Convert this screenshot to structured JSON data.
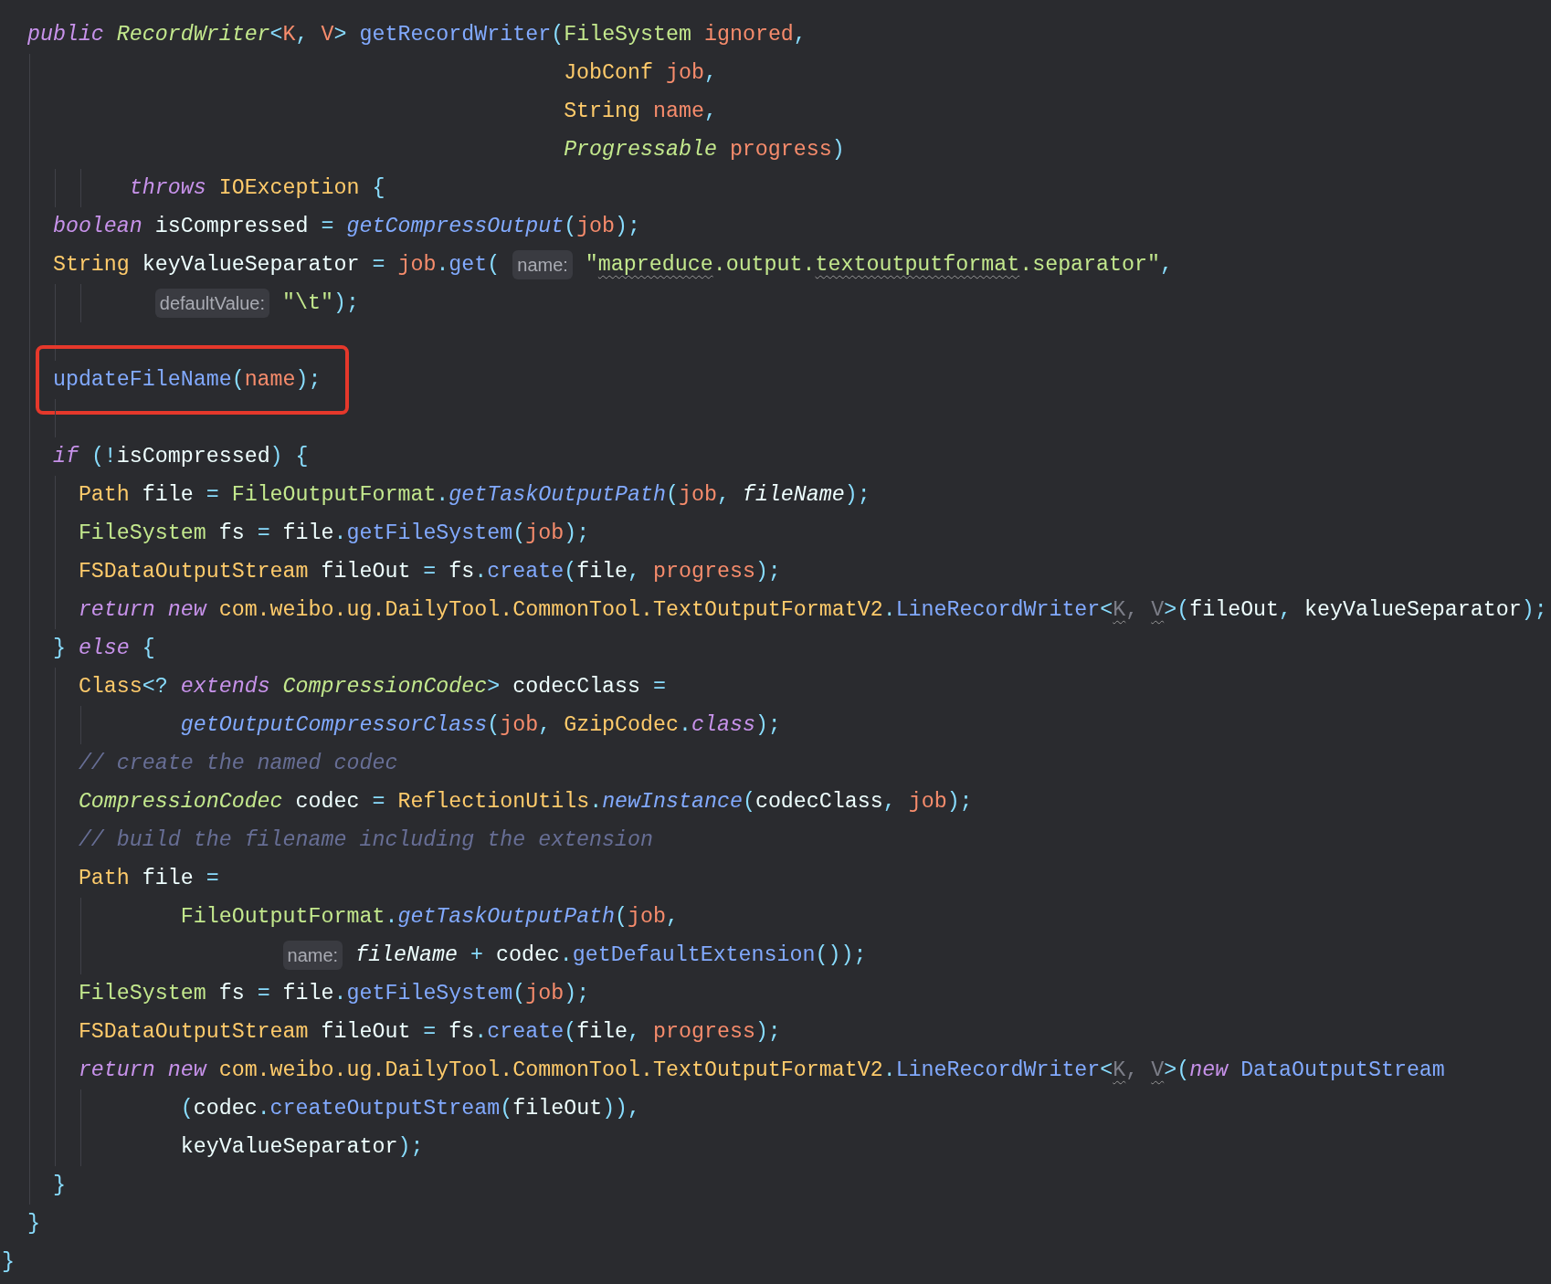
{
  "editor": {
    "lines": [
      {
        "kind": "code",
        "tokens": [
          {
            "kind": "keyword",
            "text": "  public "
          },
          {
            "kind": "type-green-italic",
            "text": "RecordWriter"
          },
          {
            "kind": "punct",
            "text": "<"
          },
          {
            "kind": "param",
            "text": "K"
          },
          {
            "kind": "punct",
            "text": ", "
          },
          {
            "kind": "param",
            "text": "V"
          },
          {
            "kind": "punct",
            "text": "> "
          },
          {
            "kind": "method",
            "text": "getRecordWriter"
          },
          {
            "kind": "punct",
            "text": "("
          },
          {
            "kind": "type-green",
            "text": "FileSystem "
          },
          {
            "kind": "param",
            "text": "ignored"
          },
          {
            "kind": "punct",
            "text": ","
          }
        ]
      },
      {
        "kind": "code",
        "tokens": [
          {
            "kind": "type",
            "text": "                                            JobConf "
          },
          {
            "kind": "param",
            "text": "job"
          },
          {
            "kind": "punct",
            "text": ","
          }
        ]
      },
      {
        "kind": "code",
        "tokens": [
          {
            "kind": "type",
            "text": "                                            String "
          },
          {
            "kind": "param",
            "text": "name"
          },
          {
            "kind": "punct",
            "text": ","
          }
        ]
      },
      {
        "kind": "code",
        "tokens": [
          {
            "kind": "type-green-italic",
            "text": "                                            Progressable "
          },
          {
            "kind": "param",
            "text": "progress"
          },
          {
            "kind": "punct",
            "text": ")"
          }
        ]
      },
      {
        "kind": "code",
        "tokens": [
          {
            "kind": "keyword",
            "text": "          throws "
          },
          {
            "kind": "type",
            "text": "IOException "
          },
          {
            "kind": "punct",
            "text": "{"
          }
        ]
      },
      {
        "kind": "code",
        "tokens": [
          {
            "kind": "keyword",
            "text": "    boolean "
          },
          {
            "kind": "plain",
            "text": "isCompressed "
          },
          {
            "kind": "punct",
            "text": "= "
          },
          {
            "kind": "method-italic",
            "text": "getCompressOutput"
          },
          {
            "kind": "punct",
            "text": "("
          },
          {
            "kind": "param",
            "text": "job"
          },
          {
            "kind": "punct",
            "text": ");"
          }
        ]
      },
      {
        "kind": "code",
        "tokens": [
          {
            "kind": "type",
            "text": "    String "
          },
          {
            "kind": "plain",
            "text": "keyValueSeparator "
          },
          {
            "kind": "punct",
            "text": "= "
          },
          {
            "kind": "param",
            "text": "job"
          },
          {
            "kind": "punct",
            "text": "."
          },
          {
            "kind": "method",
            "text": "get"
          },
          {
            "kind": "punct",
            "text": "( "
          },
          {
            "kind": "hint",
            "text": "name:"
          },
          {
            "kind": "string",
            "text": " \""
          },
          {
            "kind": "string-typo",
            "text": "mapreduce"
          },
          {
            "kind": "string",
            "text": ".output."
          },
          {
            "kind": "string-typo",
            "text": "textoutputformat"
          },
          {
            "kind": "string",
            "text": ".separator\""
          },
          {
            "kind": "punct",
            "text": ","
          }
        ]
      },
      {
        "kind": "code",
        "tokens": [
          {
            "kind": "hint",
            "text": "            defaultValue:"
          },
          {
            "kind": "string",
            "text": " \"\\t\""
          },
          {
            "kind": "punct",
            "text": ");"
          }
        ]
      },
      {
        "kind": "blank"
      },
      {
        "kind": "code",
        "highlighted": true,
        "tokens": [
          {
            "kind": "method",
            "text": "    updateFileName"
          },
          {
            "kind": "punct",
            "text": "("
          },
          {
            "kind": "param",
            "text": "name"
          },
          {
            "kind": "punct",
            "text": ");"
          }
        ]
      },
      {
        "kind": "blank"
      },
      {
        "kind": "code",
        "tokens": [
          {
            "kind": "keyword",
            "text": "    if "
          },
          {
            "kind": "punct",
            "text": "(!"
          },
          {
            "kind": "plain",
            "text": "isCompressed"
          },
          {
            "kind": "punct",
            "text": ") {"
          }
        ]
      },
      {
        "kind": "code",
        "tokens": [
          {
            "kind": "type",
            "text": "      Path "
          },
          {
            "kind": "plain",
            "text": "file "
          },
          {
            "kind": "punct",
            "text": "= "
          },
          {
            "kind": "type-green",
            "text": "FileOutputFormat"
          },
          {
            "kind": "punct",
            "text": "."
          },
          {
            "kind": "method-italic",
            "text": "getTaskOutputPath"
          },
          {
            "kind": "punct",
            "text": "("
          },
          {
            "kind": "param",
            "text": "job"
          },
          {
            "kind": "punct",
            "text": ", "
          },
          {
            "kind": "plain-italic",
            "text": "fileName"
          },
          {
            "kind": "punct",
            "text": ");"
          }
        ]
      },
      {
        "kind": "code",
        "tokens": [
          {
            "kind": "type-green",
            "text": "      FileSystem "
          },
          {
            "kind": "plain",
            "text": "fs "
          },
          {
            "kind": "punct",
            "text": "= "
          },
          {
            "kind": "plain",
            "text": "file"
          },
          {
            "kind": "punct",
            "text": "."
          },
          {
            "kind": "method",
            "text": "getFileSystem"
          },
          {
            "kind": "punct",
            "text": "("
          },
          {
            "kind": "param",
            "text": "job"
          },
          {
            "kind": "punct",
            "text": ");"
          }
        ]
      },
      {
        "kind": "code",
        "tokens": [
          {
            "kind": "type",
            "text": "      FSDataOutputStream "
          },
          {
            "kind": "plain",
            "text": "fileOut "
          },
          {
            "kind": "punct",
            "text": "= "
          },
          {
            "kind": "plain",
            "text": "fs"
          },
          {
            "kind": "punct",
            "text": "."
          },
          {
            "kind": "method",
            "text": "create"
          },
          {
            "kind": "punct",
            "text": "("
          },
          {
            "kind": "plain",
            "text": "file"
          },
          {
            "kind": "punct",
            "text": ", "
          },
          {
            "kind": "param",
            "text": "progress"
          },
          {
            "kind": "punct",
            "text": ");"
          }
        ]
      },
      {
        "kind": "code",
        "tokens": [
          {
            "kind": "keyword",
            "text": "      return new "
          },
          {
            "kind": "type",
            "text": "com.weibo.ug.DailyTool.CommonTool.TextOutputFormatV2"
          },
          {
            "kind": "punct",
            "text": "."
          },
          {
            "kind": "method",
            "text": "LineRecordWriter"
          },
          {
            "kind": "punct",
            "text": "<"
          },
          {
            "kind": "dim-typo",
            "text": "K"
          },
          {
            "kind": "dim",
            "text": ", "
          },
          {
            "kind": "dim-typo",
            "text": "V"
          },
          {
            "kind": "punct",
            "text": ">("
          },
          {
            "kind": "plain",
            "text": "fileOut"
          },
          {
            "kind": "punct",
            "text": ", "
          },
          {
            "kind": "plain",
            "text": "keyValueSeparator"
          },
          {
            "kind": "punct",
            "text": ");"
          }
        ]
      },
      {
        "kind": "code",
        "tokens": [
          {
            "kind": "punct",
            "text": "    } "
          },
          {
            "kind": "keyword",
            "text": "else "
          },
          {
            "kind": "punct",
            "text": "{"
          }
        ]
      },
      {
        "kind": "code",
        "tokens": [
          {
            "kind": "type",
            "text": "      Class"
          },
          {
            "kind": "punct",
            "text": "<? "
          },
          {
            "kind": "keyword",
            "text": "extends "
          },
          {
            "kind": "type-green-italic",
            "text": "CompressionCodec"
          },
          {
            "kind": "punct",
            "text": "> "
          },
          {
            "kind": "plain",
            "text": "codecClass "
          },
          {
            "kind": "punct",
            "text": "="
          }
        ]
      },
      {
        "kind": "code",
        "tokens": [
          {
            "kind": "method-italic",
            "text": "              getOutputCompressorClass"
          },
          {
            "kind": "punct",
            "text": "("
          },
          {
            "kind": "param",
            "text": "job"
          },
          {
            "kind": "punct",
            "text": ", "
          },
          {
            "kind": "type",
            "text": "GzipCodec"
          },
          {
            "kind": "punct",
            "text": "."
          },
          {
            "kind": "keyword",
            "text": "class"
          },
          {
            "kind": "punct",
            "text": ");"
          }
        ]
      },
      {
        "kind": "code",
        "tokens": [
          {
            "kind": "comment",
            "text": "      // create the named codec"
          }
        ]
      },
      {
        "kind": "code",
        "tokens": [
          {
            "kind": "type-green-italic",
            "text": "      CompressionCodec "
          },
          {
            "kind": "plain",
            "text": "codec "
          },
          {
            "kind": "punct",
            "text": "= "
          },
          {
            "kind": "type",
            "text": "ReflectionUtils"
          },
          {
            "kind": "punct",
            "text": "."
          },
          {
            "kind": "method-italic",
            "text": "newInstance"
          },
          {
            "kind": "punct",
            "text": "("
          },
          {
            "kind": "plain",
            "text": "codecClass"
          },
          {
            "kind": "punct",
            "text": ", "
          },
          {
            "kind": "param",
            "text": "job"
          },
          {
            "kind": "punct",
            "text": ");"
          }
        ]
      },
      {
        "kind": "code",
        "tokens": [
          {
            "kind": "comment",
            "text": "      // build the filename including the extension"
          }
        ]
      },
      {
        "kind": "code",
        "tokens": [
          {
            "kind": "type",
            "text": "      Path "
          },
          {
            "kind": "plain",
            "text": "file "
          },
          {
            "kind": "punct",
            "text": "="
          }
        ]
      },
      {
        "kind": "code",
        "tokens": [
          {
            "kind": "type-green",
            "text": "              FileOutputFormat"
          },
          {
            "kind": "punct",
            "text": "."
          },
          {
            "kind": "method-italic",
            "text": "getTaskOutputPath"
          },
          {
            "kind": "punct",
            "text": "("
          },
          {
            "kind": "param",
            "text": "job"
          },
          {
            "kind": "punct",
            "text": ","
          }
        ]
      },
      {
        "kind": "code",
        "tokens": [
          {
            "kind": "hint",
            "text": "                      name:"
          },
          {
            "kind": "plain-italic",
            "text": " fileName "
          },
          {
            "kind": "punct",
            "text": "+ "
          },
          {
            "kind": "plain",
            "text": "codec"
          },
          {
            "kind": "punct",
            "text": "."
          },
          {
            "kind": "method",
            "text": "getDefaultExtension"
          },
          {
            "kind": "punct",
            "text": "());"
          }
        ]
      },
      {
        "kind": "code",
        "tokens": [
          {
            "kind": "type-green",
            "text": "      FileSystem "
          },
          {
            "kind": "plain",
            "text": "fs "
          },
          {
            "kind": "punct",
            "text": "= "
          },
          {
            "kind": "plain",
            "text": "file"
          },
          {
            "kind": "punct",
            "text": "."
          },
          {
            "kind": "method",
            "text": "getFileSystem"
          },
          {
            "kind": "punct",
            "text": "("
          },
          {
            "kind": "param",
            "text": "job"
          },
          {
            "kind": "punct",
            "text": ");"
          }
        ]
      },
      {
        "kind": "code",
        "tokens": [
          {
            "kind": "type",
            "text": "      FSDataOutputStream "
          },
          {
            "kind": "plain",
            "text": "fileOut "
          },
          {
            "kind": "punct",
            "text": "= "
          },
          {
            "kind": "plain",
            "text": "fs"
          },
          {
            "kind": "punct",
            "text": "."
          },
          {
            "kind": "method",
            "text": "create"
          },
          {
            "kind": "punct",
            "text": "("
          },
          {
            "kind": "plain",
            "text": "file"
          },
          {
            "kind": "punct",
            "text": ", "
          },
          {
            "kind": "param",
            "text": "progress"
          },
          {
            "kind": "punct",
            "text": ");"
          }
        ]
      },
      {
        "kind": "code",
        "tokens": [
          {
            "kind": "keyword",
            "text": "      return new "
          },
          {
            "kind": "type",
            "text": "com.weibo.ug.DailyTool.CommonTool.TextOutputFormatV2"
          },
          {
            "kind": "punct",
            "text": "."
          },
          {
            "kind": "method",
            "text": "LineRecordWriter"
          },
          {
            "kind": "punct",
            "text": "<"
          },
          {
            "kind": "dim-typo",
            "text": "K"
          },
          {
            "kind": "dim",
            "text": ", "
          },
          {
            "kind": "dim-typo",
            "text": "V"
          },
          {
            "kind": "punct",
            "text": ">("
          },
          {
            "kind": "keyword",
            "text": "new "
          },
          {
            "kind": "method",
            "text": "DataOutputStream"
          }
        ]
      },
      {
        "kind": "code",
        "tokens": [
          {
            "kind": "punct",
            "text": "              ("
          },
          {
            "kind": "plain",
            "text": "codec"
          },
          {
            "kind": "punct",
            "text": "."
          },
          {
            "kind": "method",
            "text": "createOutputStream"
          },
          {
            "kind": "punct",
            "text": "("
          },
          {
            "kind": "plain",
            "text": "fileOut"
          },
          {
            "kind": "punct",
            "text": ")),"
          }
        ]
      },
      {
        "kind": "code",
        "tokens": [
          {
            "kind": "plain",
            "text": "              keyValueSeparator"
          },
          {
            "kind": "punct",
            "text": ");"
          }
        ]
      },
      {
        "kind": "code",
        "tokens": [
          {
            "kind": "punct",
            "text": "    }"
          }
        ]
      },
      {
        "kind": "code",
        "tokens": [
          {
            "kind": "punct",
            "text": "  }"
          }
        ]
      },
      {
        "kind": "code",
        "tokens": [
          {
            "kind": "punct",
            "text": "}"
          }
        ]
      }
    ]
  }
}
